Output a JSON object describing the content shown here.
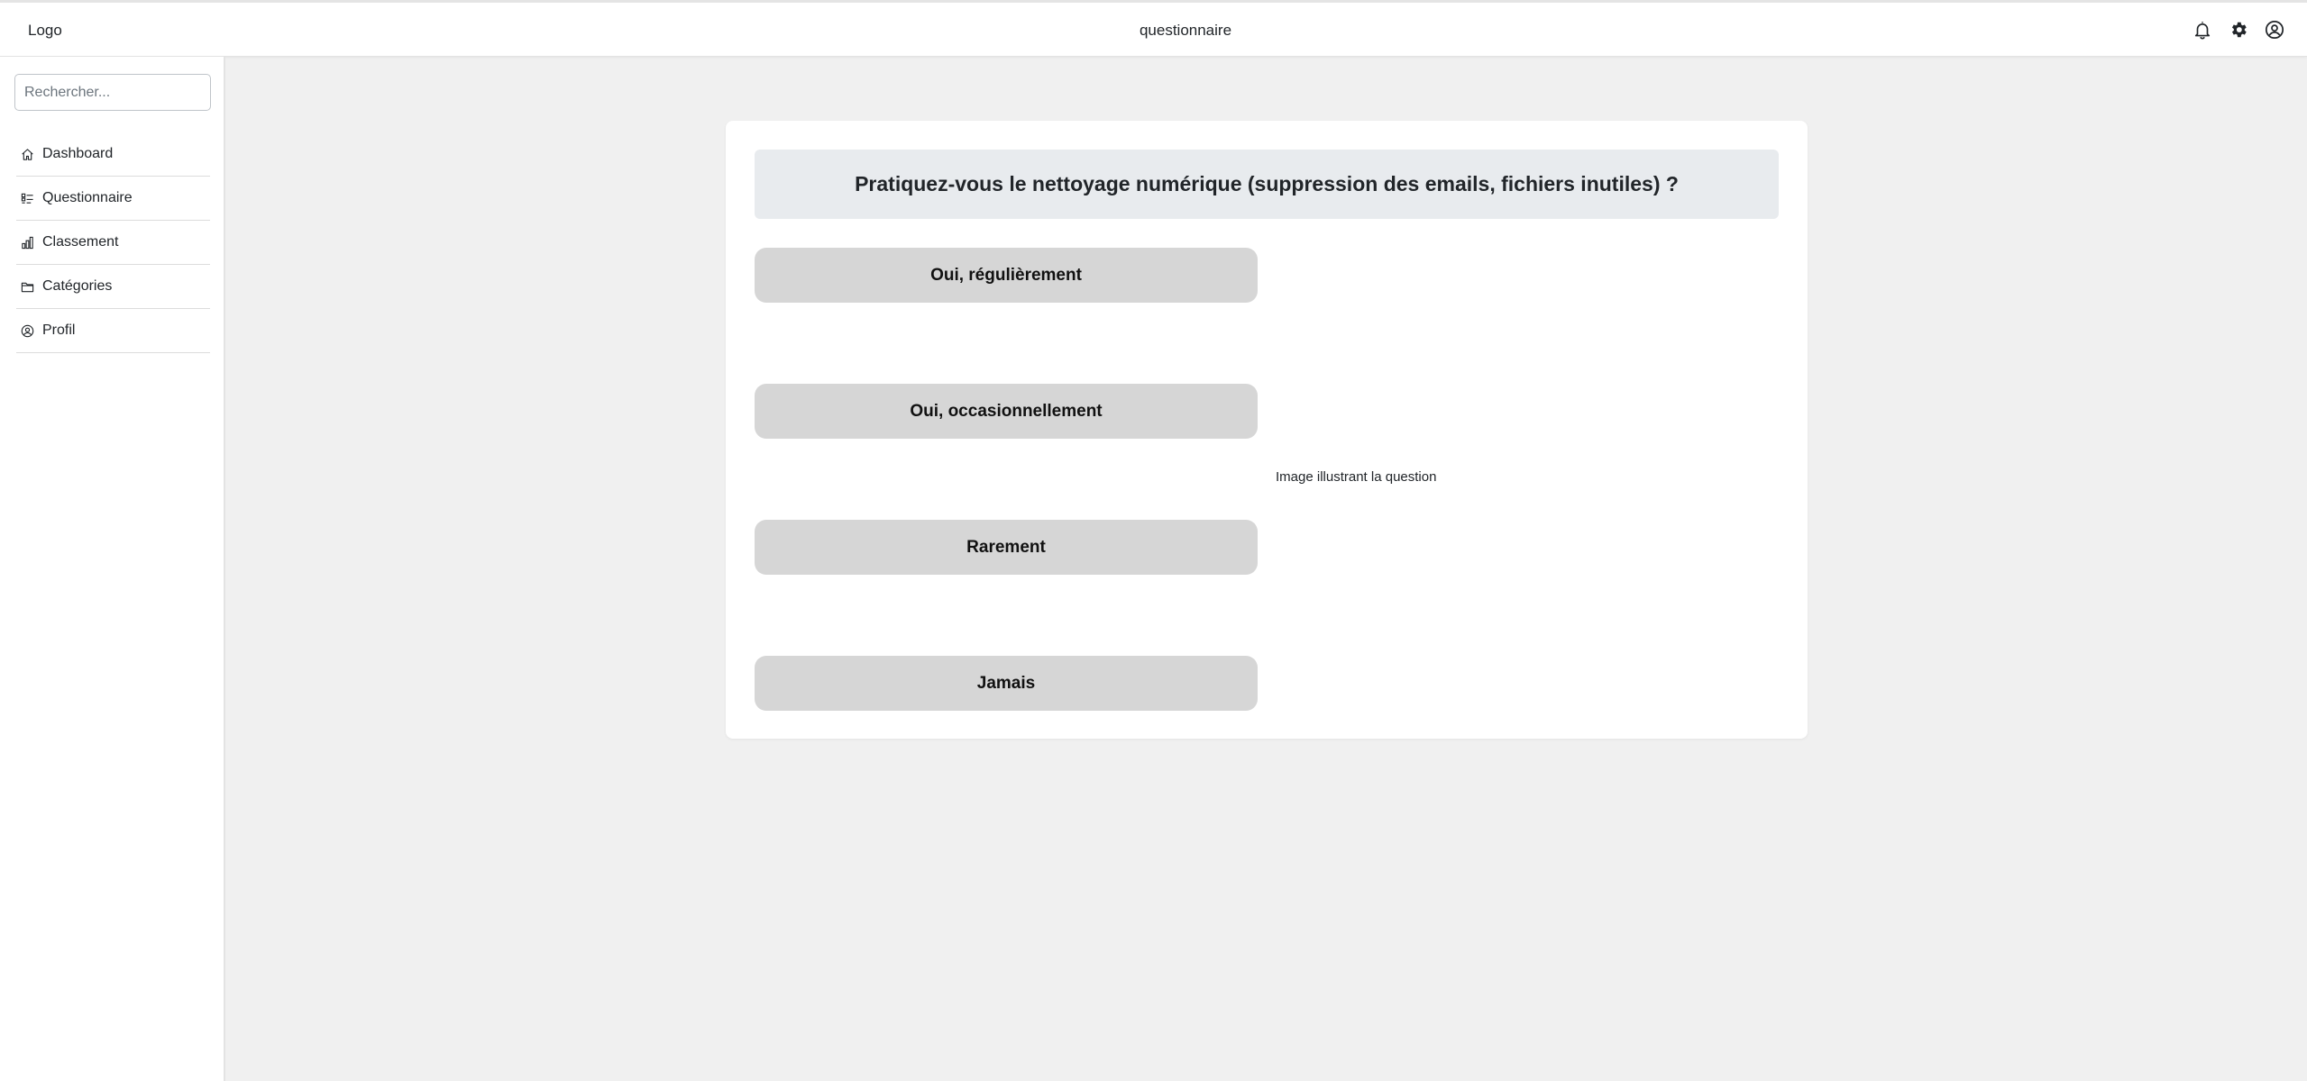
{
  "header": {
    "logo": "Logo",
    "title": "questionnaire",
    "icons": [
      "bell-icon",
      "gear-icon",
      "user-circle-icon"
    ]
  },
  "sidebar": {
    "search_placeholder": "Rechercher...",
    "items": [
      {
        "label": "Dashboard",
        "icon": "home-icon"
      },
      {
        "label": "Questionnaire",
        "icon": "list-icon"
      },
      {
        "label": "Classement",
        "icon": "bar-chart-icon"
      },
      {
        "label": "Catégories",
        "icon": "folder-icon"
      },
      {
        "label": "Profil",
        "icon": "user-circle-icon"
      }
    ]
  },
  "quiz": {
    "question": "Pratiquez-vous le nettoyage numérique (suppression des emails, fichiers inutiles) ?",
    "answers": [
      "Oui, régulièrement",
      "Oui, occasionnellement",
      "Rarement",
      "Jamais"
    ],
    "image_alt": "Image illustrant la question"
  },
  "colors": {
    "page_bg": "#f0f0f0",
    "question_bg": "#e8ebee",
    "answer_bg": "#d6d6d6",
    "text": "#212529"
  }
}
